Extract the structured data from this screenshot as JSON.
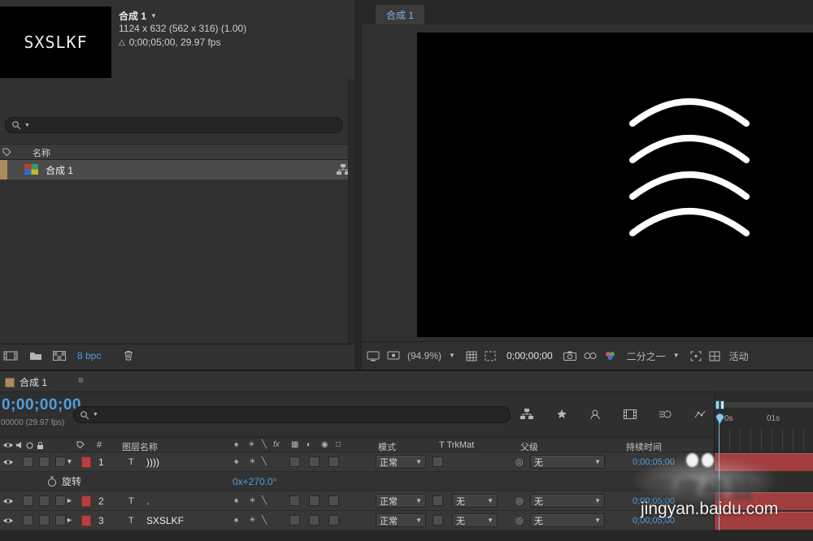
{
  "glyphs": {
    "caret_down": "▼",
    "caret_right": "►",
    "menu": "≡",
    "triangle": "△",
    "pickwhip": "◎",
    "sw_shy": "♠",
    "sw_collapse": "☀",
    "sw_quality": "╲",
    "sw_fx": "fx",
    "sw_frameblend": "▦",
    "sw_motionblur": "◐",
    "sw_adjustment": "◉",
    "sw_3d": "□"
  },
  "project": {
    "preview_text": "SXSLKF",
    "comp_name": "合成 1",
    "comp_size": "1124 x 632 (562 x 316) (1.00)",
    "comp_time": "0;00;05;00, 29.97 fps",
    "name_header": "名称",
    "item_label": "合成 1",
    "bpc": "8 bpc"
  },
  "viewer": {
    "tab": "合成 1",
    "zoom": "(94.9%)",
    "timecode": "0;00;00;00",
    "resolution": "二分之一",
    "camera_label": "活动"
  },
  "timeline": {
    "tab": "合成 1",
    "timecode": "0;00;00;00",
    "frames": "00000 (29.97 fps)",
    "ruler": {
      "t0": "0s",
      "t1": "01s"
    },
    "columns": {
      "hash": "#",
      "layer_name": "图层名称",
      "mode": "模式",
      "trkmat": "T TrkMat",
      "parent": "父级",
      "duration": "持续时间"
    },
    "layers": [
      {
        "num": "1",
        "type": "T",
        "name": "))))",
        "mode": "正常",
        "trkmat": "",
        "parent": "无",
        "duration": "0;00;05;00"
      },
      {
        "num": "2",
        "type": "T",
        "name": ".",
        "mode": "正常",
        "trkmat": "无",
        "parent": "无",
        "duration": "0;00;05;00"
      },
      {
        "num": "3",
        "type": "T",
        "name": "SXSLKF",
        "mode": "正常",
        "trkmat": "无",
        "parent": "无",
        "duration": "0;00;05;00"
      }
    ],
    "property": {
      "name": "旋转",
      "value": "0x+270.0°"
    }
  },
  "watermark": {
    "brand": "百度经验",
    "site": "jingyan.baidu.com"
  }
}
